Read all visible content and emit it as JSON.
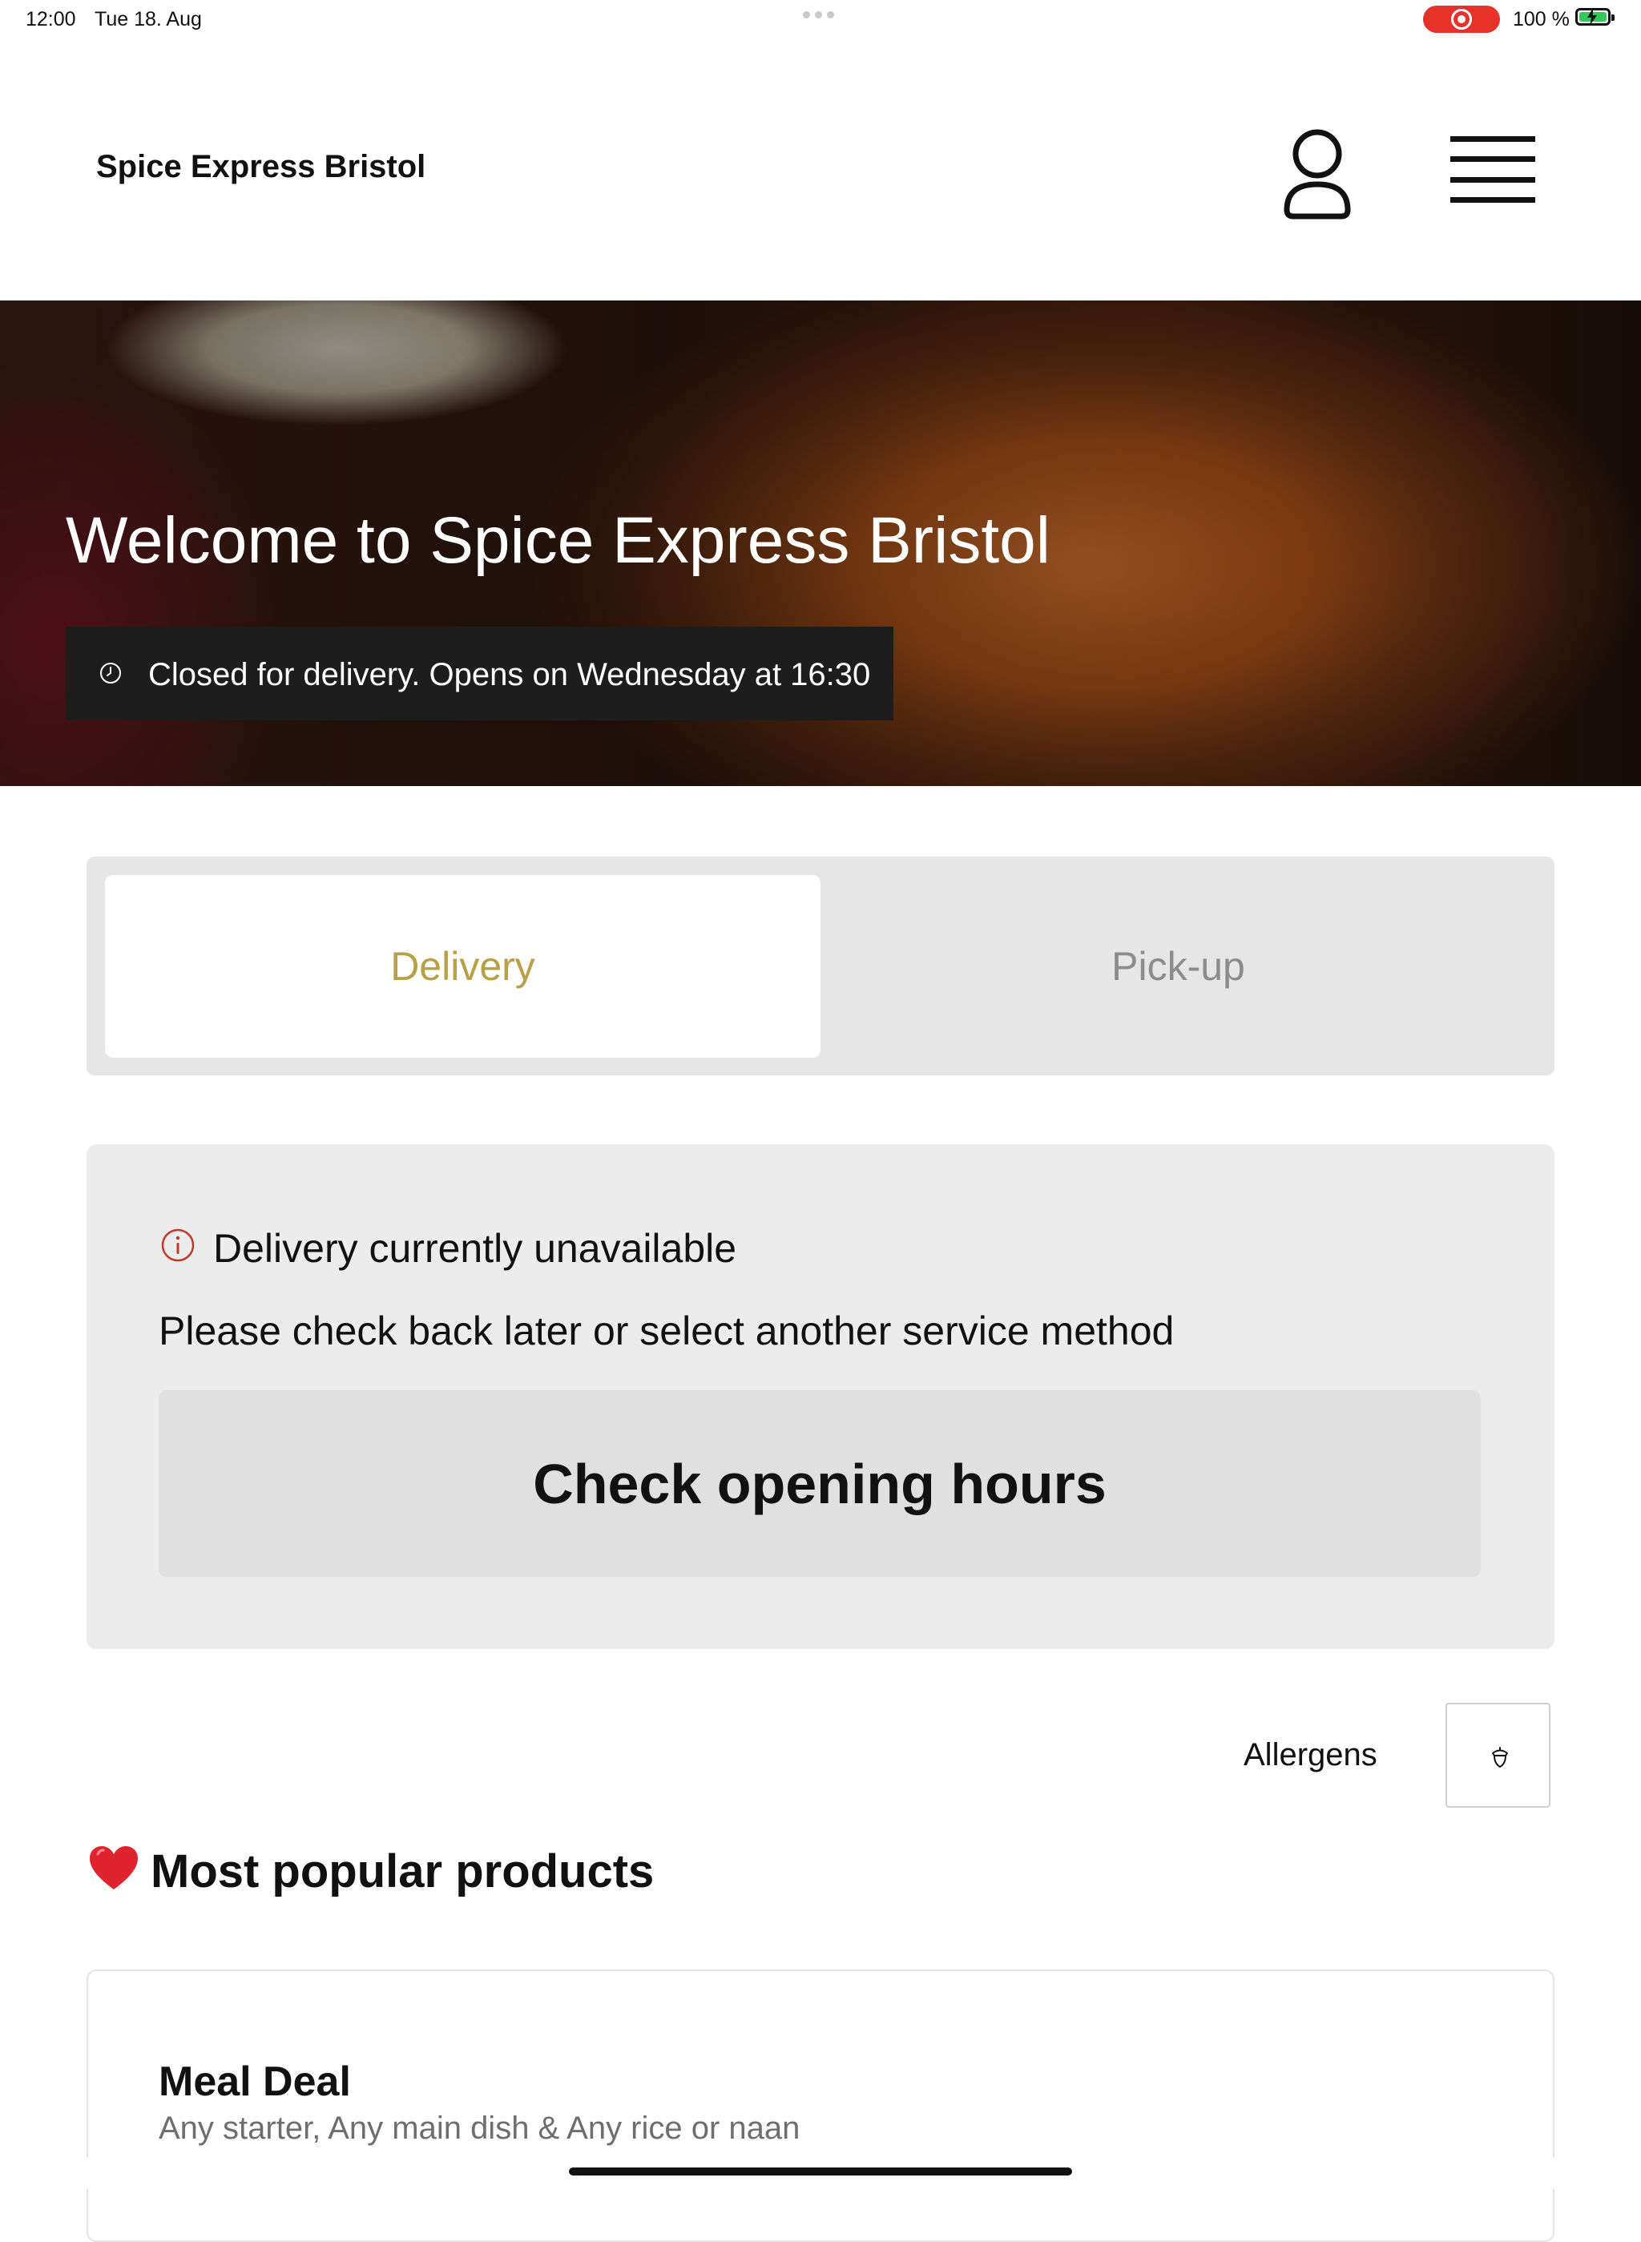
{
  "status_bar": {
    "time": "12:00",
    "date": "Tue 18. Aug",
    "battery": "100 %"
  },
  "header": {
    "brand": "Spice Express Bristol",
    "icons": [
      "user-icon",
      "menu-icon"
    ]
  },
  "hero": {
    "title": "Welcome to Spice Express Bristol",
    "closed_notice": "Closed for delivery. Opens on Wednesday at 16:30"
  },
  "service_toggle": {
    "tabs": [
      {
        "label": "Delivery",
        "selected": true
      },
      {
        "label": "Pick-up",
        "selected": false
      }
    ]
  },
  "unavailable": {
    "title": "Delivery currently unavailable",
    "message": "Please check back later or select another service method",
    "button": "Check opening hours"
  },
  "allergens": {
    "label": "Allergens"
  },
  "popular": {
    "title": "Most popular products",
    "products": [
      {
        "name": "Meal Deal",
        "description": "Any starter, Any main dish & Any rice or naan"
      }
    ]
  },
  "colors": {
    "accent": "#b9a047",
    "alert": "#c0392b",
    "recording": "#e5332a",
    "battery": "#34c759"
  }
}
